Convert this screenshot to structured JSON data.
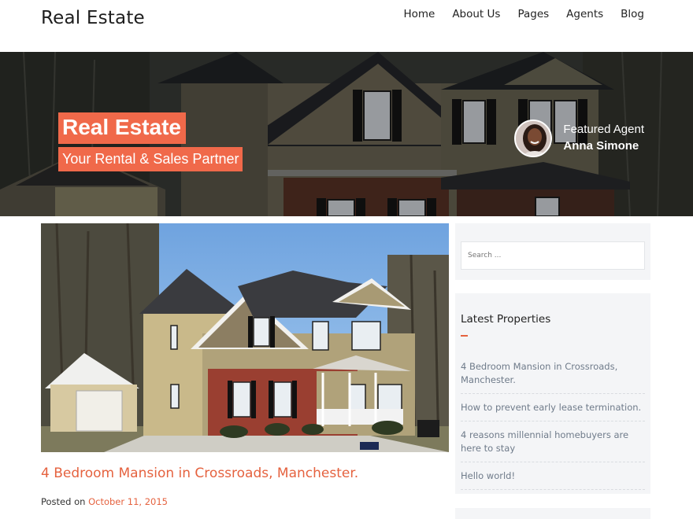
{
  "site": {
    "title": "Real Estate"
  },
  "nav": {
    "items": [
      "Home",
      "About Us",
      "Pages",
      "Agents",
      "Blog"
    ]
  },
  "hero": {
    "title": "Real Estate",
    "subtitle": "Your Rental & Sales Partner",
    "agent_label": "Featured Agent",
    "agent_name": "Anna Simone"
  },
  "post": {
    "title": "4 Bedroom Mansion in Crossroads, Manchester.",
    "posted_on_label": "Posted on",
    "date": "October 11, 2015"
  },
  "sidebar": {
    "search_placeholder": "Search ...",
    "latest_title": "Latest Properties",
    "latest_items": [
      "4 Bedroom Mansion in Crossroads, Manchester.",
      "How to prevent early lease termination.",
      "4 reasons millennial homebuyers are here to stay",
      "Hello world!"
    ]
  },
  "colors": {
    "accent": "#f0694a",
    "link": "#e5623f",
    "sidebar_bg": "#f4f5f7",
    "sidebar_text": "#6f7b8a"
  }
}
